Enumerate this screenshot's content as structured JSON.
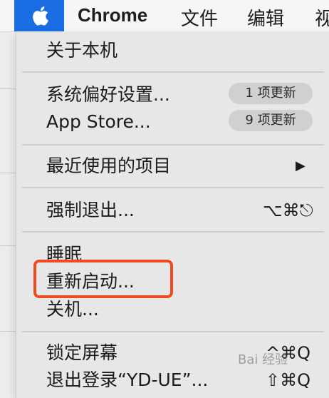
{
  "menubar": {
    "app_name": "Chrome",
    "items": [
      "文件",
      "编辑",
      "视"
    ]
  },
  "apple_menu": {
    "about": "关于本机",
    "system_prefs": {
      "label": "系统偏好设置...",
      "badge": "1 项更新"
    },
    "app_store": {
      "label": "App Store...",
      "badge": "9 项更新"
    },
    "recent_items": {
      "label": "最近使用的项目",
      "submenu_arrow": "▶"
    },
    "force_quit": {
      "label": "强制退出...",
      "shortcut": "⌥⌘⎋"
    },
    "sleep": "睡眠",
    "restart": "重新启动...",
    "shutdown": "关机...",
    "lock_screen": {
      "label": "锁定屏幕",
      "shortcut": "^⌘Q"
    },
    "logout": {
      "label": "退出登录“YD-UE”...",
      "shortcut": "⇧⌘Q"
    }
  },
  "watermark": "Bai 经验",
  "colors": {
    "apple_button": "#1a6de3",
    "highlight_box": "#ee4c1e",
    "menu_bg": "#e7e7e7"
  }
}
